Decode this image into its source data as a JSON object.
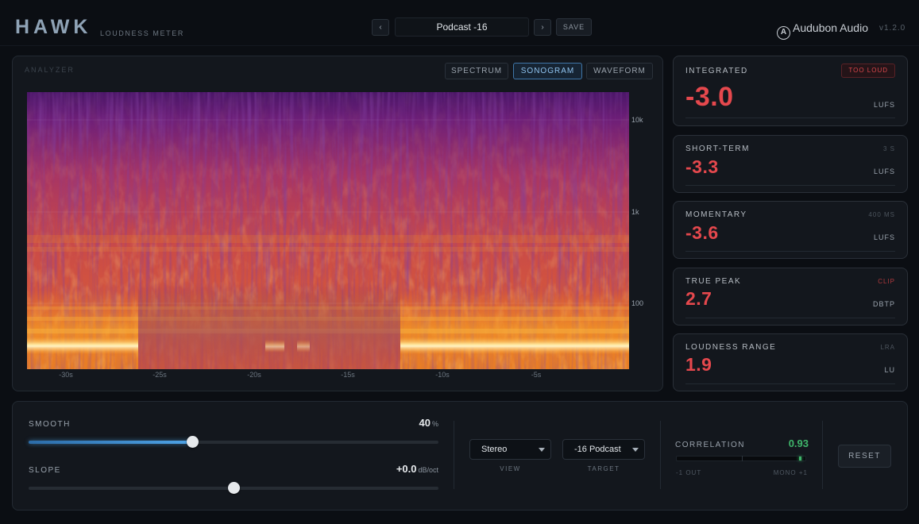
{
  "header": {
    "logo": "HAWK",
    "subtitle": "LOUDNESS METER",
    "prev_glyph": "‹",
    "next_glyph": "›",
    "preset": "Podcast -16",
    "save_label": "SAVE",
    "brand_glyph": "A",
    "brand_name": "Audubon Audio",
    "version": "v1.2.0"
  },
  "analyzer": {
    "label": "ANALYZER",
    "tabs": [
      {
        "label": "SPECTRUM",
        "active": false
      },
      {
        "label": "SONOGRAM",
        "active": true
      },
      {
        "label": "WAVEFORM",
        "active": false
      }
    ],
    "freq_labels": [
      "10k",
      "1k",
      "100"
    ],
    "time_labels": [
      "-30s",
      "-25s",
      "-20s",
      "-15s",
      "-10s",
      "-5s"
    ]
  },
  "meters": {
    "integrated": {
      "label": "INTEGRATED",
      "value": "-3.0",
      "unit": "LUFS",
      "badge": "TOO LOUD"
    },
    "short_term": {
      "label": "SHORT-TERM",
      "value": "-3.3",
      "unit": "LUFS",
      "tag": "3 S"
    },
    "momentary": {
      "label": "MOMENTARY",
      "value": "-3.6",
      "unit": "LUFS",
      "tag": "400 MS"
    },
    "true_peak": {
      "label": "TRUE PEAK",
      "value": "2.7",
      "unit": "DBTP",
      "tag": "CLIP"
    },
    "loudness_range": {
      "label": "LOUDNESS RANGE",
      "value": "1.9",
      "unit": "LU",
      "tag": "LRA"
    }
  },
  "controls": {
    "smooth": {
      "label": "SMOOTH",
      "value": "40",
      "unit": "%",
      "level": 0.4
    },
    "slope": {
      "label": "SLOPE",
      "value": "+0.0",
      "unit": "dB/oct",
      "level": 0.5
    },
    "view": {
      "selected": "Stereo",
      "caption": "VIEW"
    },
    "target": {
      "selected": "-16 Podcast",
      "caption": "TARGET"
    },
    "correlation": {
      "label": "CORRELATION",
      "value": "0.93",
      "level": 0.93,
      "left_caption": "-1 OUT",
      "right_caption": "MONO +1"
    },
    "reset_label": "RESET"
  },
  "colors": {
    "accent": "#4ea3e6",
    "alert": "#e5484d",
    "good": "#3fb66b"
  }
}
